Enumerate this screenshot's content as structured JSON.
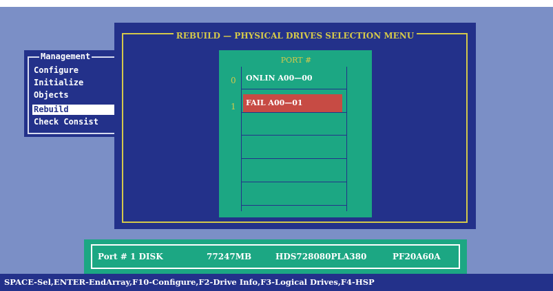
{
  "management_menu": {
    "title": "Management",
    "items": [
      {
        "label": "Configure",
        "selected": false
      },
      {
        "label": "Initialize",
        "selected": false
      },
      {
        "label": "Objects",
        "selected": false
      },
      {
        "label": "Rebuild",
        "selected": true
      },
      {
        "label": "Check Consist",
        "selected": false
      }
    ]
  },
  "dialog": {
    "title": "REBUILD — PHYSICAL DRIVES SELECTION MENU",
    "column_header": "PORT #",
    "drives": [
      {
        "index": "0",
        "label": "ONLIN A00—00",
        "status": "online"
      },
      {
        "index": "1",
        "label": "FAIL  A00—01",
        "status": "fail"
      }
    ]
  },
  "status_bar": {
    "port": "Port # 1 DISK",
    "size": "77247MB",
    "model": "HDS728080PLA380",
    "firmware": "PF20A60A"
  },
  "help_bar": {
    "text": "SPACE-Sel,ENTER-EndArray,F10-Configure,F2-Drive Info,F3-Logical Drives,F4-HSP"
  },
  "colors": {
    "background": "#7b8fc6",
    "panel_blue": "#23318a",
    "teal": "#1ca783",
    "yellow": "#d5c94a",
    "fail_red": "#c74b44"
  }
}
